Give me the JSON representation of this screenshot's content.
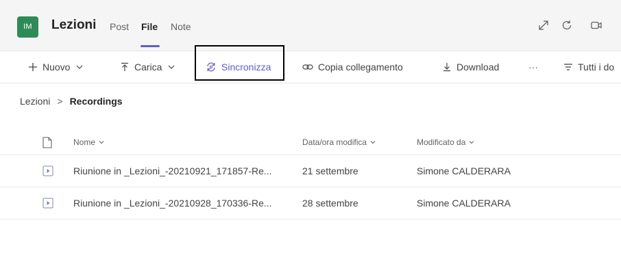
{
  "header": {
    "avatar_initials": "IM",
    "team_title": "Lezioni",
    "tabs": [
      {
        "label": "Post"
      },
      {
        "label": "File"
      },
      {
        "label": "Note"
      }
    ],
    "active_tab": "File",
    "accent_color": "#5b5fc7",
    "avatar_color": "#2e8b57"
  },
  "toolbar": {
    "new_label": "Nuovo",
    "upload_label": "Carica",
    "sync_label": "Sincronizza",
    "copy_link_label": "Copia collegamento",
    "download_label": "Download",
    "more_label": "···",
    "view_label": "Tutti i do"
  },
  "breadcrumb": {
    "root": "Lezioni",
    "separator": ">",
    "current": "Recordings"
  },
  "table": {
    "columns": {
      "name": "Nome",
      "modified_date": "Data/ora modifica",
      "modified_by": "Modificato da"
    },
    "rows": [
      {
        "name": "Riunione in _Lezioni_-20210921_171857-Re...",
        "date": "21 settembre",
        "by": "Simone CALDERARA"
      },
      {
        "name": "Riunione in _Lezioni_-20210928_170336-Re...",
        "date": "28 settembre",
        "by": "Simone CALDERARA"
      }
    ]
  }
}
